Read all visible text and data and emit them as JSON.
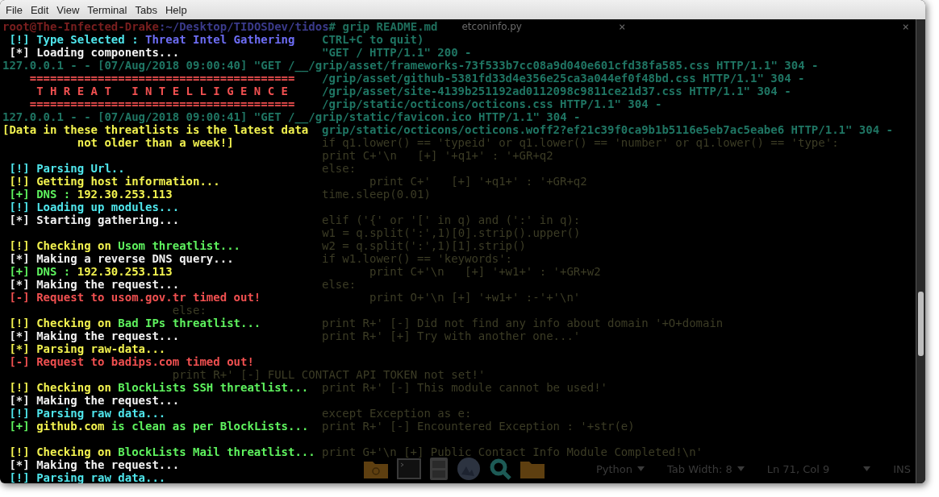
{
  "menu": [
    "File",
    "Edit",
    "View",
    "Terminal",
    "Tabs",
    "Help"
  ],
  "tab_bar": {
    "title": "etconinfo.py",
    "close_marks": [
      "×",
      "×"
    ]
  },
  "terminal": {
    "prompt": [
      {
        "text": "root@The-Infected-Drake",
        "color": "#7a1f1f"
      },
      {
        "text": ":~/Desktop/TIDOSDev/tidos",
        "color": "#3b3b8c"
      },
      {
        "text": "# grip README.md",
        "color": "#1f6e5c"
      }
    ],
    "lines": [
      {
        "kind": "output",
        "segments": [
          {
            "text": " [!] ",
            "color": "#4fe6ec"
          },
          {
            "text": "Type Selected : ",
            "color": "#4fe6ec"
          },
          {
            "text": "Threat Intel Gathering",
            "color": "#6d6df5"
          }
        ],
        "behind": {
          "kind": "log",
          "text": "CTRL+C to quit)"
        }
      },
      {
        "kind": "output",
        "segments": [
          {
            "text": " [*] Loading components...",
            "color": "#f2f2f2"
          }
        ],
        "behind": {
          "kind": "log",
          "text": "\"GET / HTTP/1.1\" 200 -"
        }
      },
      {
        "kind": "blank",
        "behind": {
          "kind": "log",
          "text": "127.0.0.1 - - [07/Aug/2018 09:00:40] \"GET /__/grip/asset/frameworks-73f533b7cc08a9d040e601cfd38fa585.css HTTP/1.1\" 304 -"
        }
      },
      {
        "kind": "output",
        "segments": [
          {
            "text": "    =======================================",
            "color": "#f05050"
          }
        ],
        "behind": {
          "kind": "log",
          "text": "/grip/asset/github-5381fd33d4e356e25ca3a044ef0f48bd.css HTTP/1.1\" 304 -"
        }
      },
      {
        "kind": "output",
        "segments": [
          {
            "text": "     T H R E A T   I N T E L L I G E N C E",
            "color": "#f05050"
          }
        ],
        "behind": {
          "kind": "log",
          "text": "/grip/asset/site-4139b251192ad0112098c9811ce21d37.css HTTP/1.1\" 304 -"
        }
      },
      {
        "kind": "output",
        "segments": [
          {
            "text": "    =======================================",
            "color": "#f05050"
          }
        ],
        "behind": {
          "kind": "log",
          "text": "/grip/static/octicons/octicons.css HTTP/1.1\" 304 -"
        }
      },
      {
        "kind": "blank",
        "behind": {
          "kind": "log",
          "text": "127.0.0.1 - - [07/Aug/2018 09:00:41] \"GET /__/grip/static/favicon.ico HTTP/1.1\" 304 -"
        }
      },
      {
        "kind": "output",
        "segments": [
          {
            "text": "[Data in these threatlists is the latest data",
            "color": "#f2f24f"
          }
        ],
        "behind": {
          "kind": "log",
          "text": "grip/static/octicons/octicons.woff2?ef21c39f0ca9b1b5116e5eb7ac5eabe6 HTTP/1.1\" 304 -"
        }
      },
      {
        "kind": "output",
        "segments": [
          {
            "text": "           not older than a week!]",
            "color": "#f2f24f"
          }
        ],
        "behind": {
          "kind": "code",
          "text": "if q1.lower() == 'typeid' or q1.lower() == 'number' or q1.lower() == 'type':"
        }
      },
      {
        "kind": "blank",
        "behind": {
          "kind": "code",
          "text": "                                               print C+'\\n   [+] '+q1+' : '+GR+q2"
        }
      },
      {
        "kind": "output",
        "segments": [
          {
            "text": " [!] Parsing Url..",
            "color": "#4fe6ec"
          }
        ],
        "behind": {
          "kind": "code",
          "text": "else:"
        }
      },
      {
        "kind": "output",
        "segments": [
          {
            "text": " [!] Getting host information...",
            "color": "#f2f24f"
          }
        ],
        "behind": {
          "kind": "code",
          "text": "       print C+'   [+] '+q1+' : '+GR+q2"
        }
      },
      {
        "kind": "output",
        "segments": [
          {
            "text": " [+] DNS : ",
            "color": "#5ef25e"
          },
          {
            "text": "192.30.253.113",
            "color": "#f2f24f"
          }
        ],
        "behind": {
          "kind": "code",
          "text": "time.sleep(0.01)"
        }
      },
      {
        "kind": "output",
        "segments": [
          {
            "text": " [!] Loading up modules...",
            "color": "#4fe6ec"
          }
        ]
      },
      {
        "kind": "output",
        "segments": [
          {
            "text": " [*] Starting gathering...",
            "color": "#f2f2f2"
          }
        ],
        "behind": {
          "kind": "code",
          "text": "elif ('{' or '[' in q) and (':' in q):"
        }
      },
      {
        "kind": "blank",
        "behind": {
          "kind": "code",
          "text": "                                               w1 = q.split(':',1)[0].strip().upper()"
        }
      },
      {
        "kind": "output",
        "segments": [
          {
            "text": " [!] Checking on ",
            "color": "#f2f24f"
          },
          {
            "text": "Usom threatlist...",
            "color": "#5ef25e"
          }
        ],
        "behind": {
          "kind": "code",
          "text": "w2 = q.split(':',1)[1].strip()"
        }
      },
      {
        "kind": "output",
        "segments": [
          {
            "text": " [*] Making a reverse DNS query...",
            "color": "#f2f2f2"
          }
        ],
        "behind": {
          "kind": "code",
          "text": "if w1.lower() == 'keywords':"
        }
      },
      {
        "kind": "output",
        "segments": [
          {
            "text": " [+] DNS : ",
            "color": "#5ef25e"
          },
          {
            "text": "192.30.253.113",
            "color": "#f2f24f"
          }
        ],
        "behind": {
          "kind": "code",
          "text": "       print C+'\\n   [+] '+w1+' : '+GR+w2"
        }
      },
      {
        "kind": "output",
        "segments": [
          {
            "text": " [*] Making the request...",
            "color": "#f2f2f2"
          }
        ],
        "behind": {
          "kind": "code",
          "text": "else:"
        }
      },
      {
        "kind": "output",
        "segments": [
          {
            "text": " [-] Request to usom.gov.tr timed out!",
            "color": "#f05050"
          }
        ],
        "behind": {
          "kind": "code",
          "text": "       print O+'\\n [+] '+w1+' :-'+'\\n'"
        }
      },
      {
        "kind": "blank",
        "behind": {
          "kind": "code",
          "text": "                         else:"
        }
      },
      {
        "kind": "output",
        "segments": [
          {
            "text": " [!] Checking on ",
            "color": "#f2f24f"
          },
          {
            "text": "Bad IPs threatlist...",
            "color": "#5ef25e"
          }
        ],
        "behind": {
          "kind": "code",
          "text": "print R+' [-] Did not find any info about domain '+O+domain"
        }
      },
      {
        "kind": "output",
        "segments": [
          {
            "text": " [*] Making the request...",
            "color": "#f2f2f2"
          }
        ],
        "behind": {
          "kind": "code",
          "text": "print R+' [+] Try with another one...'"
        }
      },
      {
        "kind": "output",
        "segments": [
          {
            "text": " [*] Parsing raw-data...",
            "color": "#f2f24f"
          }
        ]
      },
      {
        "kind": "output",
        "segments": [
          {
            "text": " [-] Request to badips.com timed out!",
            "color": "#f05050"
          }
        ]
      },
      {
        "kind": "blank",
        "behind": {
          "kind": "code",
          "text": "                         print R+' [-] FULL CONTACT API TOKEN not set!'"
        }
      },
      {
        "kind": "output",
        "segments": [
          {
            "text": " [!] Checking on ",
            "color": "#f2f24f"
          },
          {
            "text": "BlockLists SSH threatlist...",
            "color": "#5ef25e"
          }
        ],
        "behind": {
          "kind": "code",
          "text": "print R+' [-] This module cannot be used!'"
        }
      },
      {
        "kind": "output",
        "segments": [
          {
            "text": " [*] Making the request...",
            "color": "#f2f2f2"
          }
        ]
      },
      {
        "kind": "output",
        "segments": [
          {
            "text": " [!] Parsing raw data...",
            "color": "#4fe6ec"
          }
        ],
        "behind": {
          "kind": "code",
          "text": "except Exception as e:"
        }
      },
      {
        "kind": "output",
        "segments": [
          {
            "text": " [+] ",
            "color": "#5ef25e"
          },
          {
            "text": "github.com",
            "color": "#f2f24f"
          },
          {
            "text": " is clean as per BlockLists...",
            "color": "#5ef25e"
          }
        ],
        "behind": {
          "kind": "code",
          "text": "print R+' [-] Encountered Exception : '+str(e)"
        }
      },
      {
        "kind": "blank"
      },
      {
        "kind": "output",
        "segments": [
          {
            "text": " [!] Checking on ",
            "color": "#f2f24f"
          },
          {
            "text": "BlockLists Mail threatlist...",
            "color": "#5ef25e"
          }
        ],
        "behind": {
          "kind": "code",
          "text": "print G+'\\n [+] Public Contact Info Module Completed!\\n'"
        }
      },
      {
        "kind": "output",
        "segments": [
          {
            "text": " [*] Making the request...",
            "color": "#f2f2f2"
          }
        ]
      },
      {
        "kind": "output",
        "segments": [
          {
            "text": " [!] Parsing raw data...",
            "color": "#4fe6ec"
          }
        ]
      }
    ]
  },
  "status_bar": {
    "language": "Python",
    "tab_width": "Tab Width: 8",
    "position": "Ln 71, Col 9",
    "mode": "INS"
  }
}
